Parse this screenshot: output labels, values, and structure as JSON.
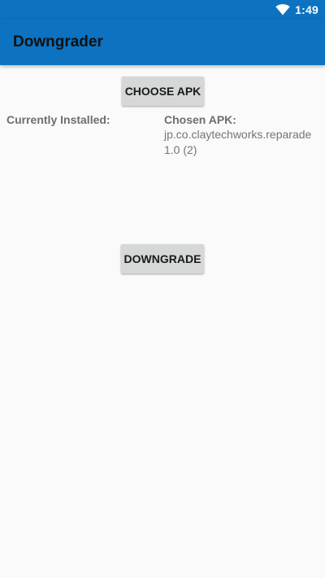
{
  "status_bar": {
    "time": "1:49",
    "icons": [
      "wifi-icon"
    ],
    "color": "#0D72C0"
  },
  "app_bar": {
    "title": "Downgrader",
    "color": "#0D72C0"
  },
  "actions": {
    "choose_apk_label": "CHOOSE APK",
    "downgrade_label": "DOWNGRADE"
  },
  "info": {
    "installed_label": "Currently Installed:",
    "chosen_label": "Chosen APK:",
    "chosen_package": "jp.co.claytechworks.reparade",
    "chosen_version": "1.0 (2)"
  }
}
